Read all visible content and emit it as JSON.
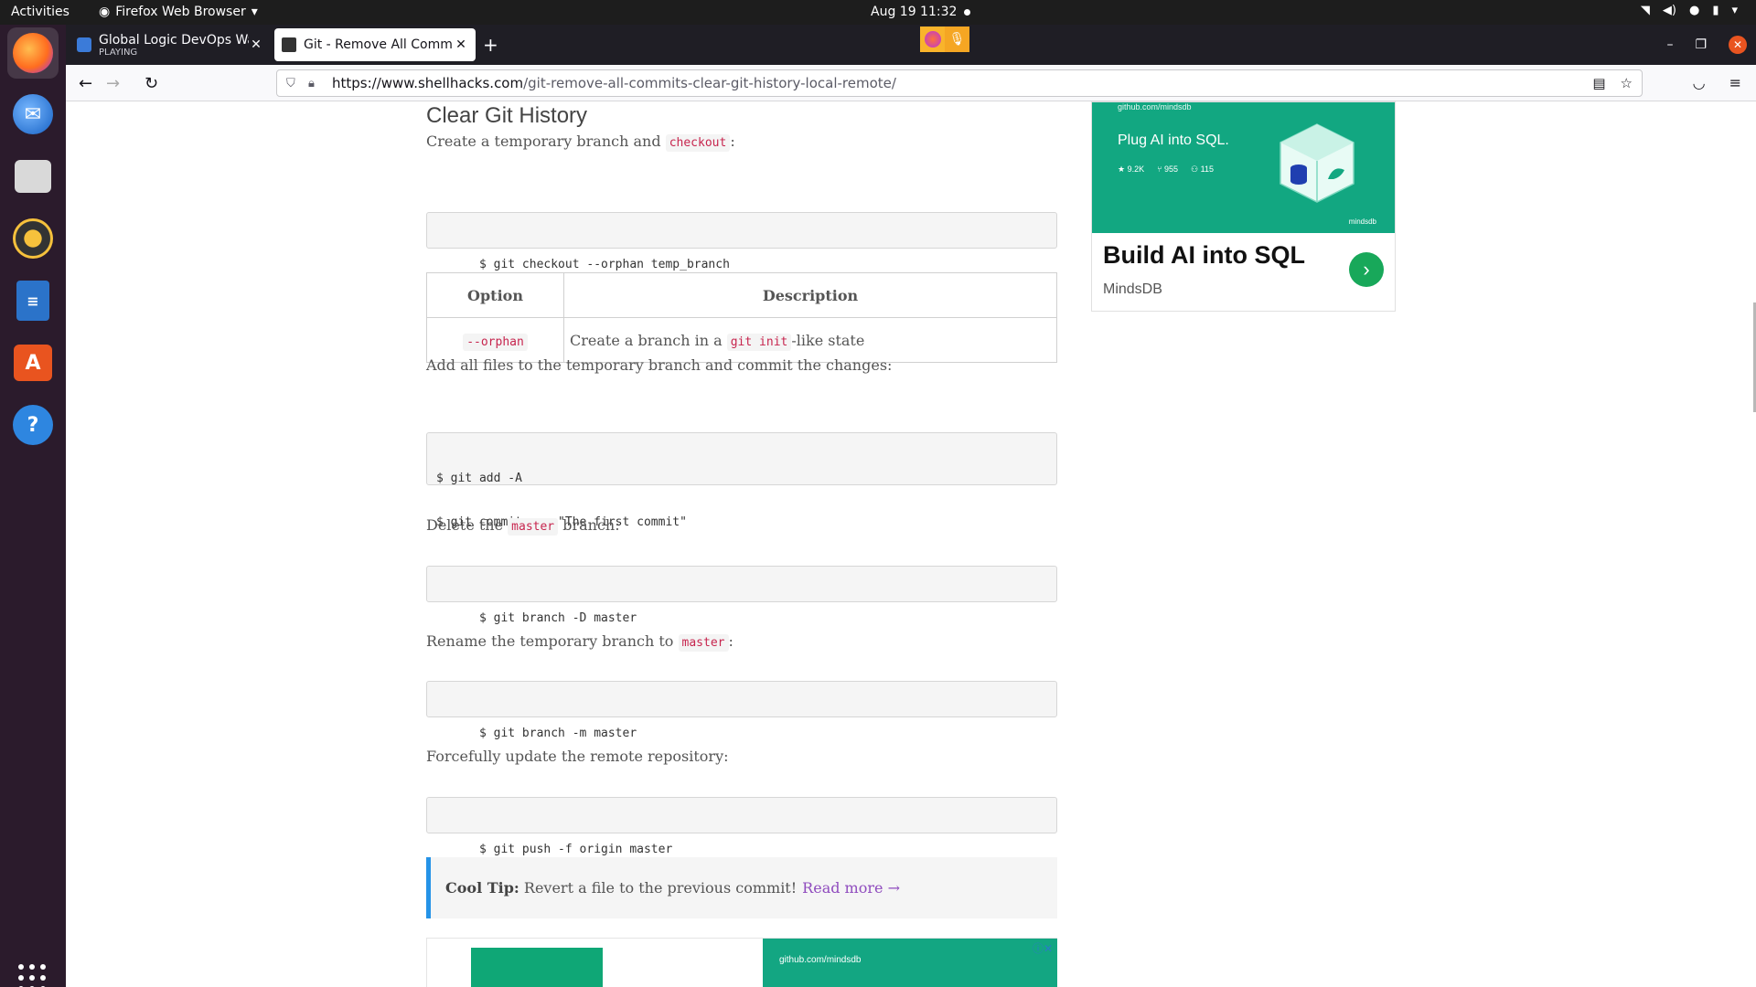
{
  "system": {
    "activities": "Activities",
    "app_name": "Firefox Web Browser",
    "clock": "Aug 19  11:32"
  },
  "browser": {
    "tabs": [
      {
        "title": "Global Logic DevOps Wa",
        "subtitle": "PLAYING"
      },
      {
        "title": "Git - Remove All Commits"
      }
    ],
    "new_tab": "+",
    "url_host": "https://www.shellhacks.com",
    "url_path": "/git-remove-all-commits-clear-git-history-local-remote/"
  },
  "article": {
    "heading": "Clear Git History",
    "p1_before": "Create a temporary branch and",
    "p1_code": "checkout",
    "p1_after": ":",
    "code1": "$ git checkout --orphan temp_branch",
    "table": {
      "col_option": "Option",
      "col_description": "Description",
      "row_option": "--orphan",
      "row_desc_before": "Create a branch in a",
      "row_desc_code": "git init",
      "row_desc_after": "-like state"
    },
    "p2": "Add all files to the temporary branch and commit the changes:",
    "code2_line1": "$ git add -A",
    "code2_line2": "$ git commit -am \"The first commit\"",
    "p3_before": "Delete the",
    "p3_code": "master",
    "p3_after": "branch:",
    "code3": "$ git branch -D master",
    "p4_before": "Rename the temporary branch to",
    "p4_code": "master",
    "p4_after": ":",
    "code4": "$ git branch -m master",
    "p5": "Forcefully update the remote repository:",
    "code5": "$ git push -f origin master",
    "tip_label": "Cool Tip:",
    "tip_text": "Revert a file to the previous commit!",
    "tip_link": "Read more →"
  },
  "ads": {
    "side": {
      "source": "github.com/mindsdb",
      "tagline": "Plug AI into SQL.",
      "stars": "9.2K",
      "forks": "955",
      "contributors": "115",
      "logo": "mindsdb",
      "headline": "Build AI into SQL",
      "brand": "MindsDB"
    },
    "bottom": {
      "source": "github.com/mindsdb",
      "close": "ⓘ✕"
    }
  },
  "colors": {
    "accent_link": "#8f4bbe",
    "tip_border": "#2593e7",
    "ad_green": "#12a781",
    "inline_code": "#c7254e"
  }
}
